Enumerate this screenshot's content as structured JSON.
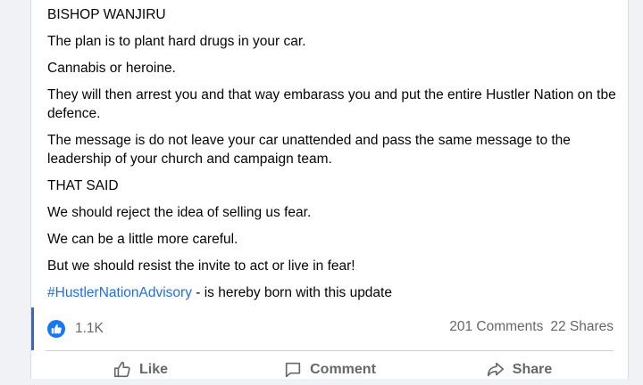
{
  "post": {
    "paragraphs": [
      "BISHOP WANJIRU",
      "The plan is to plant hard drugs in your car.",
      "Cannabis or heroine.",
      "They will then arrest you and that way embarass you and put the entire Hustler Nation on tbe defence.",
      "The message is do not leave your car unattended and pass the same message to the leadership of your church and campaign team.",
      "THAT SAID",
      "We should reject the idea of selling us fear.",
      "We can be a little more careful.",
      "But we should resist the invite to act or live  in fear!"
    ],
    "hashtag": "#HustlerNationAdvisory",
    "hashtag_suffix": " - is hereby born with this update"
  },
  "reactions": {
    "icon": "like-icon",
    "count": "1.1K"
  },
  "stats": {
    "comments": "201 Comments",
    "shares": "22 Shares"
  },
  "actions": {
    "like_label": "Like",
    "comment_label": "Comment",
    "share_label": "Share",
    "like_icon": "thumbs-up-icon",
    "comment_icon": "comment-icon",
    "share_icon": "share-arrow-icon"
  },
  "colors": {
    "accent": "#1877f2",
    "hashtag": "#216fdb",
    "muted_text": "#65676b"
  }
}
